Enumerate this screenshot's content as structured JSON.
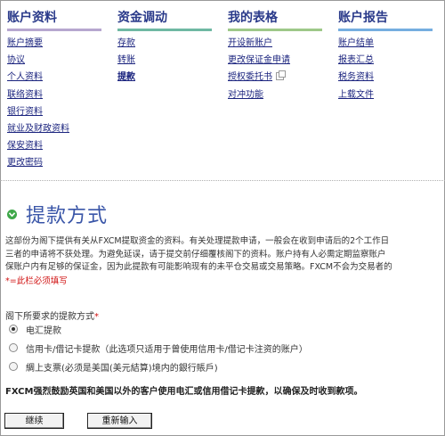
{
  "nav": [
    {
      "title": "账户资料",
      "color": "#b7a7cf",
      "items": [
        {
          "label": "账户摘要",
          "bold": false,
          "external": false
        },
        {
          "label": "协议",
          "bold": false,
          "external": false
        },
        {
          "label": "个人资料",
          "bold": false,
          "external": false
        },
        {
          "label": "联络资料",
          "bold": false,
          "external": false
        },
        {
          "label": "银行资料",
          "bold": false,
          "external": false
        },
        {
          "label": "就业及财政资料",
          "bold": false,
          "external": false
        },
        {
          "label": "保安资料",
          "bold": false,
          "external": false
        },
        {
          "label": "更改密码",
          "bold": false,
          "external": false
        }
      ]
    },
    {
      "title": "资金调动",
      "color": "#6fb8a3",
      "items": [
        {
          "label": "存款",
          "bold": false,
          "external": false
        },
        {
          "label": "转账",
          "bold": false,
          "external": false
        },
        {
          "label": "提款",
          "bold": true,
          "external": false
        }
      ]
    },
    {
      "title": "我的表格",
      "color": "#9ec889",
      "items": [
        {
          "label": "开设新账户",
          "bold": false,
          "external": false
        },
        {
          "label": "更改保证金申请",
          "bold": false,
          "external": false
        },
        {
          "label": "授权委托书",
          "bold": false,
          "external": true
        },
        {
          "label": "对冲功能",
          "bold": false,
          "external": false
        }
      ]
    },
    {
      "title": "账户报告",
      "color": "#76aee0",
      "items": [
        {
          "label": "账户结单",
          "bold": false,
          "external": false
        },
        {
          "label": "报表汇总",
          "bold": false,
          "external": false
        },
        {
          "label": "税务资料",
          "bold": false,
          "external": false
        },
        {
          "label": "上载文件",
          "bold": false,
          "external": false
        }
      ]
    }
  ],
  "section": {
    "title": "提款方式",
    "paragraph": [
      "这部份为阁下提供有关从FXCM提取资金的资料。有关处理提款申请，一般会在收到申请后的2个工作日",
      "三者的申请将不获处理。为避免延误，请于提交前仔细覆核阁下的资料。账户持有人必需定期监察账户",
      "保账户内有足够的保证金，因为此提款有可能影响现有的未平仓交易或交易策略。FXCM不会为交易者的"
    ],
    "required_note": "*=此栏必须填写"
  },
  "form": {
    "method_label": "阁下所要求的提款方式",
    "required_mark": "*",
    "options": [
      {
        "label": "电汇提款",
        "checked": true
      },
      {
        "label": "信用卡/借记卡提款（此选项只适用于曾使用信用卡/借记卡注资的账户）",
        "checked": false
      },
      {
        "label": "綢上支票(必须是美国(美元結算)境内的銀行賬戶)",
        "checked": false
      }
    ],
    "notice": "FXCM强烈鼓励英国和美国以外的客户使用电汇或信用借记卡提款，以确保及时收到款项。",
    "continue_label": "继续",
    "reset_label": "重新输入"
  }
}
